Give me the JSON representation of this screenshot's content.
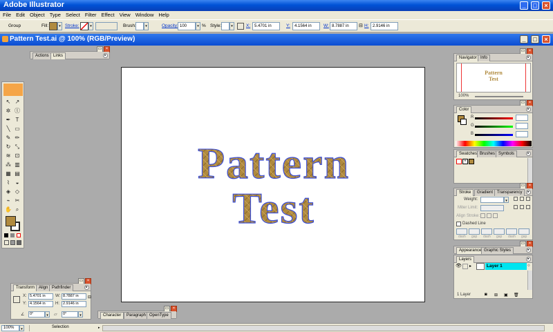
{
  "app": {
    "title": "Adobe Illustrator",
    "min": "_",
    "max": "□",
    "close": "×"
  },
  "menu": [
    "File",
    "Edit",
    "Object",
    "Type",
    "Select",
    "Filter",
    "Effect",
    "View",
    "Window",
    "Help"
  ],
  "control": {
    "selection_label": "Group",
    "fill_label": "Fill:",
    "stroke_label": "Stroke:",
    "brush_label": "Brush:",
    "opacity_label": "Opacity:",
    "opacity_value": "100",
    "opacity_unit": "%",
    "style_label": "Style:",
    "x_label": "X:",
    "x_value": "5.4701 in",
    "y_label": "Y:",
    "y_value": "4.1564 in",
    "w_label": "W:",
    "w_value": "8.7887 in",
    "h_label": "H:",
    "h_value": "2.9146 in",
    "fill_color": "#b08a3e"
  },
  "document": {
    "title": "Pattern Test.ai @ 100% (RGB/Preview)",
    "artwork_line1": "Pattern",
    "artwork_line2": "Test",
    "pattern_color": "#b08a3e"
  },
  "panels": {
    "actions": {
      "tabs": [
        "Actions",
        "Links"
      ]
    },
    "navigator": {
      "tabs": [
        "Navigator",
        "Info"
      ],
      "thumb_line1": "Pattern",
      "thumb_line2": "Test",
      "zoom": "100%"
    },
    "color": {
      "tabs": [
        "Color"
      ],
      "r": "R",
      "g": "G",
      "b": "B"
    },
    "swatches": {
      "tabs": [
        "Swatches",
        "Brushes",
        "Symbols"
      ]
    },
    "stroke": {
      "tabs": [
        "Stroke",
        "Gradient",
        "Transparency"
      ],
      "weight_label": "Weight:",
      "miter_label": "Miter Limit:",
      "align_label": "Align Stroke:",
      "dashed_label": "Dashed Line",
      "dash_labels": [
        "dash",
        "gap",
        "dash",
        "gap",
        "dash",
        "gap"
      ]
    },
    "appearance": {
      "tabs": [
        "Appearance",
        "Graphic Styles"
      ]
    },
    "layers": {
      "tabs": [
        "Layers"
      ],
      "layer_name": "Layer 1",
      "footer": "1 Layer"
    },
    "transform": {
      "tabs": [
        "Transform",
        "Align",
        "Pathfinder"
      ],
      "x_label": "X:",
      "x_value": "5.4701 in",
      "y_label": "Y:",
      "y_value": "4.1564 in",
      "w_label": "W:",
      "w_value": "8.7887 in",
      "h_label": "H:",
      "h_value": "2.9146 in",
      "rot_value": "0°",
      "shear_value": "0°"
    },
    "character": {
      "tabs": [
        "Character",
        "Paragraph",
        "OpenType"
      ]
    }
  },
  "status": {
    "zoom": "100%",
    "mode": "Selection"
  }
}
